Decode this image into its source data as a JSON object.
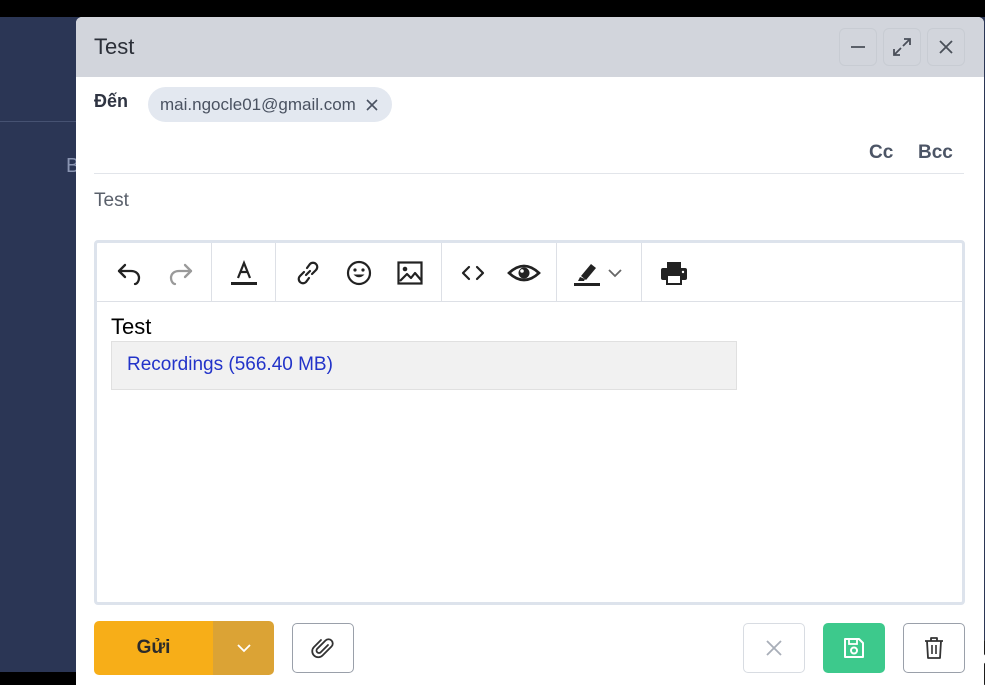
{
  "background": {
    "partial_letter": "B"
  },
  "compose": {
    "title": "Test",
    "to_label": "Đến",
    "recipient": "mai.ngocle01@gmail.com",
    "cc_label": "Cc",
    "bcc_label": "Bcc",
    "subject": "Test"
  },
  "toolbar_icons": [
    "undo-icon",
    "redo-icon",
    "font-color-icon",
    "link-icon",
    "emoji-icon",
    "image-icon",
    "code-icon",
    "preview-icon",
    "highlight-icon",
    "chevron-down-icon",
    "print-icon"
  ],
  "editor": {
    "body_text": "Test",
    "attachment": "Recordings (566.40 MB)"
  },
  "footer": {
    "send_label": "Gửi"
  },
  "colors": {
    "accent_send": "#f7ae18",
    "send_dropdown": "#dba335",
    "save": "#3dc98c",
    "link": "#2233c9",
    "titlebar": "#d2d5dc"
  }
}
